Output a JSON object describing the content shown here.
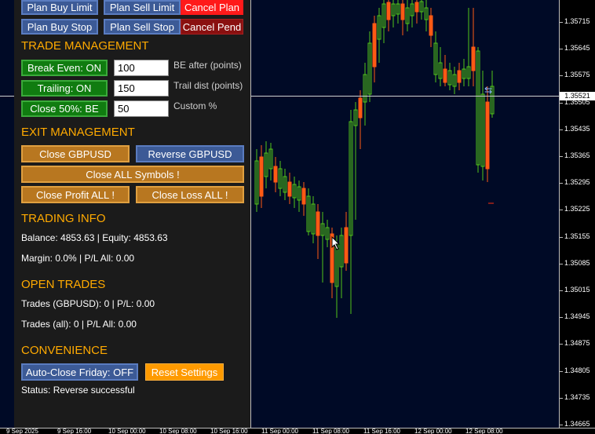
{
  "top_buttons": {
    "plan_buy_limit": "Plan Buy Limit",
    "plan_sell_limit": "Plan Sell Limit",
    "cancel_plan": "Cancel Plan",
    "plan_buy_stop": "Plan Buy Stop",
    "plan_sell_stop": "Plan Sell Stop",
    "cancel_pend": "Cancel Pend"
  },
  "trade_management": {
    "heading": "TRADE MANAGEMENT",
    "break_even": "Break Even: ON",
    "trailing": "Trailing: ON",
    "close_half": "Close 50%: BE",
    "be_value": "100",
    "trail_value": "150",
    "custom_value": "50",
    "be_label": "BE after (points)",
    "trail_label": "Trail dist (points)",
    "custom_label": "Custom %"
  },
  "exit_management": {
    "heading": "EXIT MANAGEMENT",
    "close_symbol": "Close GBPUSD",
    "reverse_symbol": "Reverse GBPUSD",
    "close_all": "Close ALL Symbols !",
    "close_profit": "Close Profit ALL !",
    "close_loss": "Close Loss ALL !"
  },
  "trading_info": {
    "heading": "TRADING INFO",
    "balance_line": "Balance: 4853.63 | Equity: 4853.63",
    "margin_line": "Margin: 0.0% | P/L All: 0.00"
  },
  "open_trades": {
    "heading": "OPEN TRADES",
    "symbol_line": "Trades (GBPUSD): 0 | P/L: 0.00",
    "all_line": "Trades (all): 0 | P/L All: 0.00"
  },
  "convenience": {
    "heading": "CONVENIENCE",
    "auto_close": "Auto-Close Friday: OFF",
    "reset": "Reset Settings",
    "status": "Status: Reverse successful"
  },
  "price_axis": {
    "current_price": "1.35521",
    "labels": [
      "1.35715",
      "1.35645",
      "1.35575",
      "1.35505",
      "1.35435",
      "1.35365",
      "1.35295",
      "1.35225",
      "1.35155",
      "1.35085",
      "1.35015",
      "1.34945",
      "1.34875",
      "1.34805",
      "1.34735",
      "1.34665"
    ]
  },
  "time_axis": {
    "labels": [
      "9 Sep 2025",
      "9 Sep 16:00",
      "10 Sep 00:00",
      "10 Sep 08:00",
      "10 Sep 16:00",
      "11 Sep 00:00",
      "11 Sep 08:00",
      "11 Sep 16:00",
      "12 Sep 00:00",
      "12 Sep 08:00"
    ]
  },
  "colors": {
    "background": "#000a26",
    "bull": "#52c41a",
    "bear": "#ff5a14",
    "accent": "#ffaa00"
  }
}
